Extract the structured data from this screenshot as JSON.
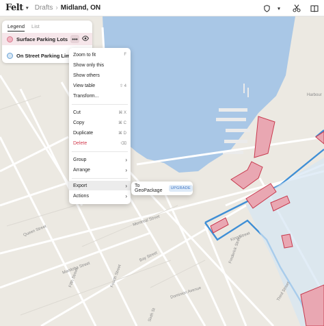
{
  "topbar": {
    "logo": "Felt",
    "breadcrumb_drafts": "Drafts",
    "separator": "›",
    "title": "Midland, ON",
    "icons": [
      "shield-icon",
      "chevron-down-icon",
      "scissors-icon",
      "book-icon"
    ]
  },
  "legend": {
    "tabs": [
      "Legend",
      "List"
    ],
    "layers": [
      {
        "name": "Surface Parking Lots",
        "color": "#e25b6f"
      },
      {
        "name": "On Street Parking Limit",
        "color": "#3f8fd6"
      }
    ]
  },
  "context_menu": {
    "items": [
      {
        "label": "Zoom to fit",
        "shortcut": "F"
      },
      {
        "label": "Show only this",
        "shortcut": ""
      },
      {
        "label": "Show others",
        "shortcut": ""
      },
      {
        "label": "View table",
        "shortcut": "⇧ 4"
      },
      {
        "label": "Transform...",
        "shortcut": ""
      },
      {
        "label": "Cut",
        "shortcut": "⌘ X"
      },
      {
        "label": "Copy",
        "shortcut": "⌘ C"
      },
      {
        "label": "Duplicate",
        "shortcut": "⌘ D"
      },
      {
        "label": "Delete",
        "shortcut": "⌫"
      },
      {
        "label": "Group",
        "shortcut": "›"
      },
      {
        "label": "Arrange",
        "shortcut": "›"
      },
      {
        "label": "Export",
        "shortcut": "›"
      },
      {
        "label": "Actions",
        "shortcut": "›"
      }
    ]
  },
  "submenu": {
    "label": "To GeoPackage",
    "badge": "UPGRADE"
  },
  "map_labels": {
    "harbour": "Harbour",
    "montreal": "Montreal Street",
    "bay": "Bay Street",
    "queen": "Queen Street",
    "manitoba": "Manitoba Street",
    "fifth": "Fifth Street",
    "fourth": "Fourth Street",
    "dominion": "Dominion Avenue",
    "king": "King Street",
    "frederick": "Frederick Street",
    "sixth": "Sixth St",
    "third": "Third Street"
  },
  "colors": {
    "water": "#a9c7e6",
    "land": "#ece9e2",
    "road": "#ffffff",
    "parking_fill": "#e9a7b2",
    "parking_stroke": "#c83a4e",
    "limit_stroke": "#3f8fd6"
  }
}
